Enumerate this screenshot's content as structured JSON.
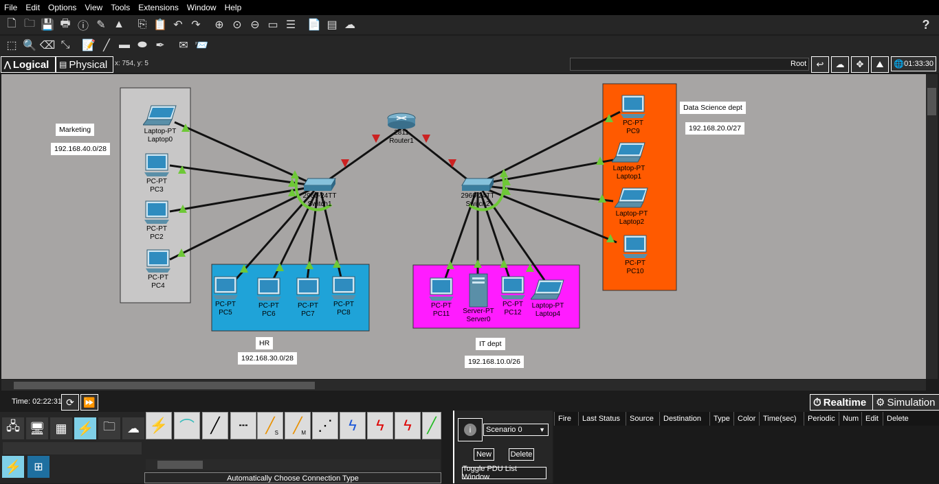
{
  "menu": [
    "File",
    "Edit",
    "Options",
    "View",
    "Tools",
    "Extensions",
    "Window",
    "Help"
  ],
  "toolbar1": {
    "help": "?",
    "icons": [
      "new-file-icon",
      "open-folder-icon",
      "save-icon",
      "print-icon",
      "info-icon",
      "activity-wizard-icon",
      "custom-device-icon",
      "copy-icon",
      "paste-icon",
      "undo-icon",
      "redo-icon",
      "zoom-in-icon",
      "zoom-reset-icon",
      "zoom-out-icon",
      "drawing-palette-icon",
      "custom-devices-dialog-icon",
      "notes-icon",
      "device-list-icon",
      "cloud-image-icon"
    ]
  },
  "toolbar2": {
    "icons": [
      "select-icon",
      "inspect-icon",
      "delete-icon",
      "resize-icon",
      "place-note-icon",
      "draw-line-icon",
      "draw-rectangle-icon",
      "draw-ellipse-icon",
      "freeform-icon",
      "add-simple-pdu-icon",
      "add-complex-pdu-icon"
    ]
  },
  "modes": {
    "logical": "Logical",
    "physical": "Physical",
    "coords": "x: 754, y: 5",
    "root": "Root",
    "clock": "01:33:30"
  },
  "labels": {
    "marketing": "Marketing",
    "marketing_net": "192.168.40.0/28",
    "hr": "HR",
    "hr_net": "192.168.30.0/28",
    "it": "IT dept",
    "it_net": "192.168.10.0/26",
    "ds": "Data Science dept",
    "ds_net": "192.168.20.0/27"
  },
  "colors": {
    "marketing": "#c8c7c7",
    "hr": "#1fa3d8",
    "it": "#ff1cff",
    "ds": "#ff5a00",
    "workspace": "#a7a5a4",
    "link_up": "#6ec837",
    "link_down": "#cc2222"
  },
  "devices": {
    "router1": {
      "model": "2811",
      "name": "Router1"
    },
    "switch1": {
      "model": "2960-24TT",
      "name": "Switch1"
    },
    "switch2": {
      "model": "2960-24TT",
      "name": "Switch2"
    },
    "laptop0": {
      "model": "Laptop-PT",
      "name": "Laptop0"
    },
    "pc3": {
      "model": "PC-PT",
      "name": "PC3"
    },
    "pc2": {
      "model": "PC-PT",
      "name": "PC2"
    },
    "pc4": {
      "model": "PC-PT",
      "name": "PC4"
    },
    "pc5": {
      "model": "PC-PT",
      "name": "PC5"
    },
    "pc6": {
      "model": "PC-PT",
      "name": "PC6"
    },
    "pc7": {
      "model": "PC-PT",
      "name": "PC7"
    },
    "pc8": {
      "model": "PC-PT",
      "name": "PC8"
    },
    "pc11": {
      "model": "PC-PT",
      "name": "PC11"
    },
    "server0": {
      "model": "Server-PT",
      "name": "Server0"
    },
    "pc12": {
      "model": "PC-PT",
      "name": "PC12"
    },
    "laptop4": {
      "model": "Laptop-PT",
      "name": "Laptop4"
    },
    "pc9": {
      "model": "PC-PT",
      "name": "PC9"
    },
    "laptop1": {
      "model": "Laptop-PT",
      "name": "Laptop1"
    },
    "laptop2": {
      "model": "Laptop-PT",
      "name": "Laptop2"
    },
    "pc10": {
      "model": "PC-PT",
      "name": "PC10"
    }
  },
  "bottom": {
    "time": "Time: 02:22:31",
    "realtime": "Realtime",
    "simulation": "Simulation",
    "connection_type": "Automatically Choose Connection Type",
    "scenario": "Scenario 0",
    "new": "New",
    "delete": "Delete",
    "toggle_pdu": "Toggle PDU List Window",
    "pdu_columns": [
      "Fire",
      "Last Status",
      "Source",
      "Destination",
      "Type",
      "Color",
      "Time(sec)",
      "Periodic",
      "Num",
      "Edit",
      "Delete"
    ],
    "connection_labels": [
      "",
      "",
      "",
      "",
      "",
      "S",
      "M",
      "",
      "",
      "",
      "",
      ""
    ]
  }
}
